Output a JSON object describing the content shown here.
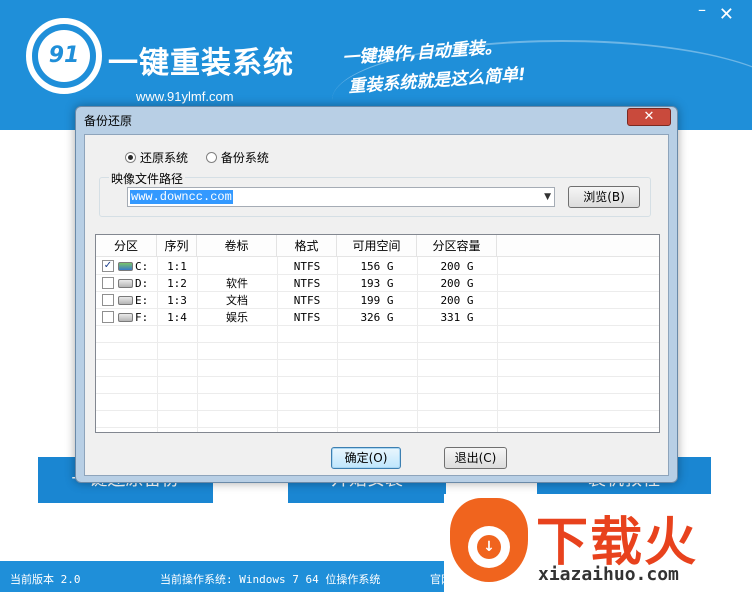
{
  "app": {
    "logo_text": "91",
    "title": "一键重装系统",
    "url": "www.91ylmf.com",
    "slogan_line1": "一键操作,自动重装。",
    "slogan_line2": "重装系统就是这么简单!",
    "minimize_symbol": "–",
    "close_symbol": "✕",
    "brand_color": "#1f8fd9"
  },
  "buttons": {
    "a": "一键还原备份",
    "b": "开始安装",
    "c": "装机教程"
  },
  "statusbar": {
    "version": "当前版本 2.0",
    "os": "当前操作系统: Windows 7 64 位操作系统",
    "website": "官网"
  },
  "watermark": {
    "text": "下载火",
    "sub": "xiazaihuo.com",
    "color": "#e8421d"
  },
  "dialog": {
    "title": "备份还原",
    "close_symbol": "✕",
    "radio_restore": "还原系统",
    "radio_backup": "备份系统",
    "selected_mode": "还原系统",
    "path_label": "映像文件路径",
    "path_value": "www.downcc.com",
    "browse_label": "浏览(B)",
    "ok_label": "确定(O)",
    "exit_label": "退出(C)"
  },
  "table": {
    "headers": [
      "分区",
      "序列",
      "卷标",
      "格式",
      "可用空间",
      "分区容量"
    ],
    "rows": [
      {
        "drive": "C:",
        "index": "1:1",
        "label": "",
        "format": "NTFS",
        "free": "156 G",
        "size": "200 G",
        "checked": "✓"
      },
      {
        "drive": "D:",
        "index": "1:2",
        "label": "软件",
        "format": "NTFS",
        "free": "193 G",
        "size": "200 G",
        "checked": ""
      },
      {
        "drive": "E:",
        "index": "1:3",
        "label": "文档",
        "format": "NTFS",
        "free": "199 G",
        "size": "200 G",
        "checked": ""
      },
      {
        "drive": "F:",
        "index": "1:4",
        "label": "娱乐",
        "format": "NTFS",
        "free": "326 G",
        "size": "331 G",
        "checked": ""
      }
    ]
  }
}
